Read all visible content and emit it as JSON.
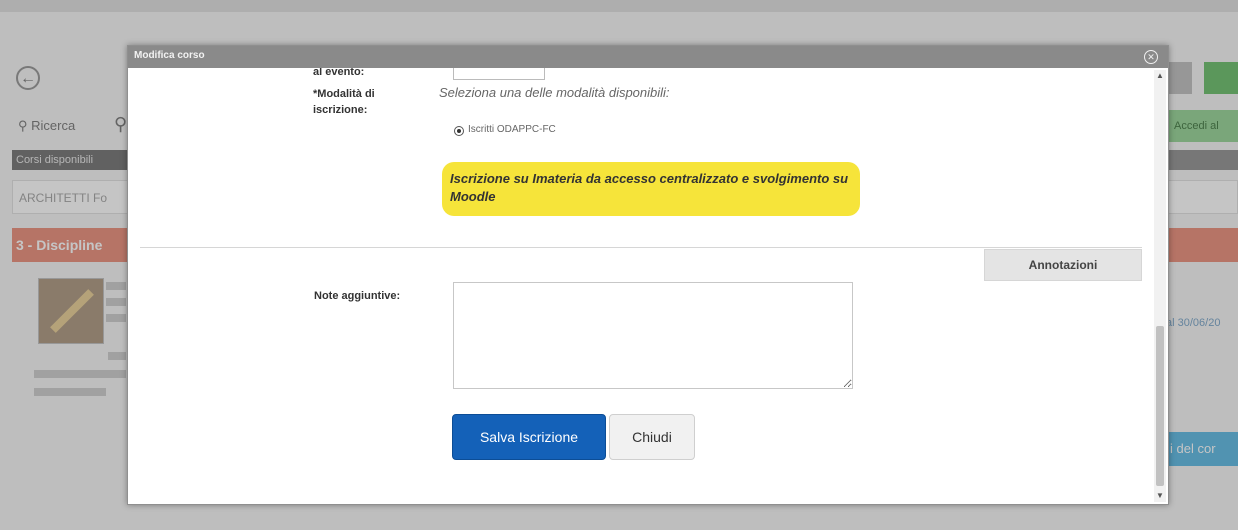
{
  "background": {
    "search_label": "Ricerca",
    "tab_label": "Corsi disponibili",
    "field_value": "ARCHITETTI Fo",
    "banner_label": "3 - Discipline",
    "right_button_label": "Accedi al",
    "right_link_text": "al 30/06/20",
    "right_bottom_button_label": "i del cor"
  },
  "modal": {
    "title": "Modifica corso",
    "close_icon": "close-icon",
    "partial_label": "al evento:",
    "modalita_label": "*Modalità di iscrizione:",
    "modalita_helper": "Seleziona una delle modalità disponibili:",
    "radio_option": "Iscritti ODAPPC-FC",
    "radio_selected": true,
    "highlight_text": "Iscrizione su Imateria da accesso centralizzato e svolgimento su Moodle",
    "annotazioni_button": "Annotazioni",
    "note_label": "Note aggiuntive:",
    "note_value": "",
    "save_button": "Salva Iscrizione",
    "close_button": "Chiudi"
  },
  "colors": {
    "primary_button": "#1461b8",
    "highlight": "#f6e43a",
    "titlebar": "#8a8a8a"
  }
}
